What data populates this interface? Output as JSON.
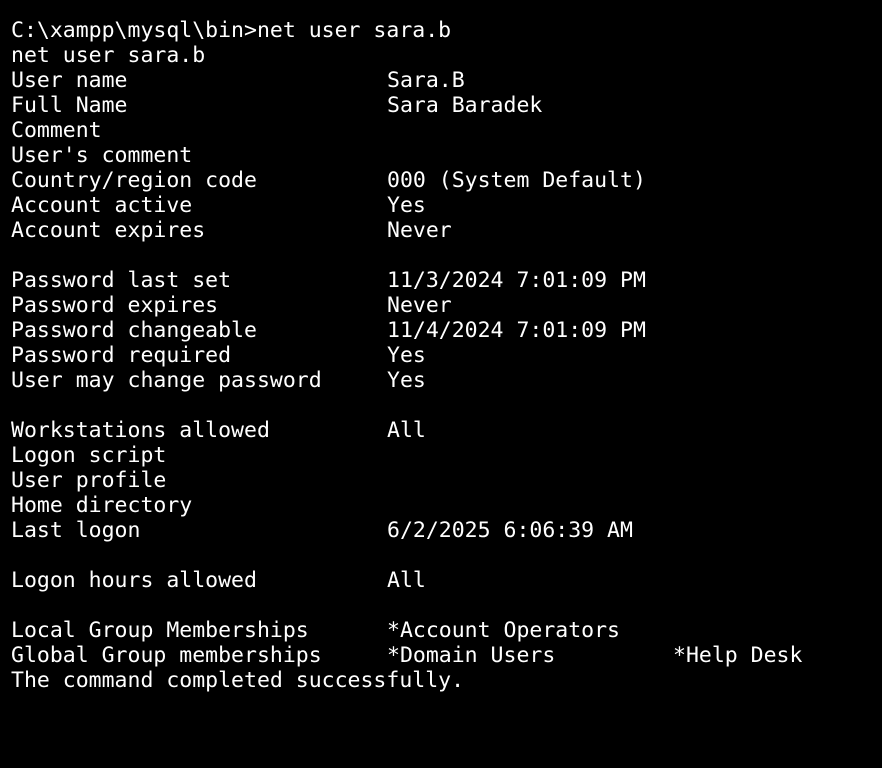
{
  "colors": {
    "background": "#000000",
    "text": "#ffffff"
  },
  "terminal": {
    "prompt_line": "C:\\xampp\\mysql\\bin>net user sara.b",
    "echo_line": "net user sara.b",
    "fields": [
      {
        "label": "User name",
        "value": "Sara.B"
      },
      {
        "label": "Full Name",
        "value": "Sara Baradek"
      },
      {
        "label": "Comment",
        "value": ""
      },
      {
        "label": "User's comment",
        "value": ""
      },
      {
        "label": "Country/region code",
        "value": "000 (System Default)"
      },
      {
        "label": "Account active",
        "value": "Yes"
      },
      {
        "label": "Account expires",
        "value": "Never"
      },
      {
        "label": "Password last set",
        "value": "11/3/2024 7:01:09 PM"
      },
      {
        "label": "Password expires",
        "value": "Never"
      },
      {
        "label": "Password changeable",
        "value": "11/4/2024 7:01:09 PM"
      },
      {
        "label": "Password required",
        "value": "Yes"
      },
      {
        "label": "User may change password",
        "value": "Yes"
      },
      {
        "label": "Workstations allowed",
        "value": "All"
      },
      {
        "label": "Logon script",
        "value": ""
      },
      {
        "label": "User profile",
        "value": ""
      },
      {
        "label": "Home directory",
        "value": ""
      },
      {
        "label": "Last logon",
        "value": "6/2/2025 6:06:39 AM"
      },
      {
        "label": "Logon hours allowed",
        "value": "All"
      },
      {
        "label": "Local Group Memberships",
        "value": "*Account Operators"
      },
      {
        "label": "Global Group memberships",
        "value": "*Domain Users",
        "value2": "*Help Desk"
      }
    ],
    "completion_line": "The command completed successfully."
  }
}
